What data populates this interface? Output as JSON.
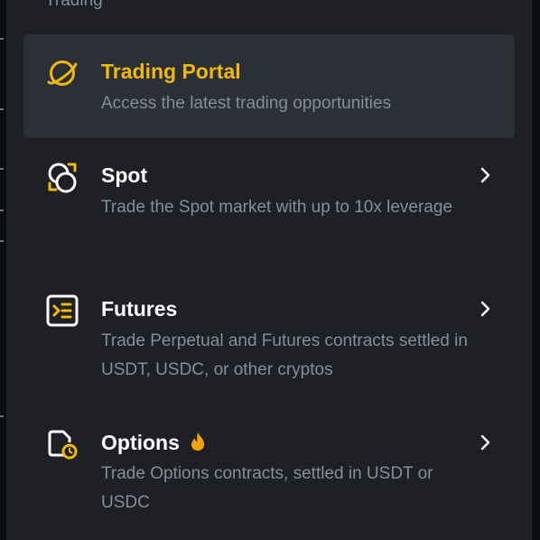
{
  "section": {
    "label": "Trading"
  },
  "menu": {
    "items": [
      {
        "title": "Trading Portal",
        "description": "Access the latest trading opportunities",
        "icon": "planet-icon",
        "active": true
      },
      {
        "title": "Spot",
        "description": "Trade the Spot market with up to 10x leverage",
        "icon": "spot-icon",
        "chevron": "chevron-right-icon"
      },
      {
        "title": "Futures",
        "description": "Trade Perpetual and Futures contracts settled in USDT, USDC, or other cryptos",
        "icon": "futures-icon",
        "chevron": "chevron-right-icon"
      },
      {
        "title": "Options",
        "description": "Trade Options contracts, settled in USDT or USDC",
        "icon": "options-icon",
        "badge_icon": "fire-icon",
        "chevron": "chevron-right-icon"
      }
    ]
  },
  "colors": {
    "panel": "#1e2026",
    "active_bg": "#2b2f36",
    "accent": "#f0b90b",
    "title": "#ffffff",
    "description": "#848e9c",
    "fire": "#f0a30b"
  }
}
